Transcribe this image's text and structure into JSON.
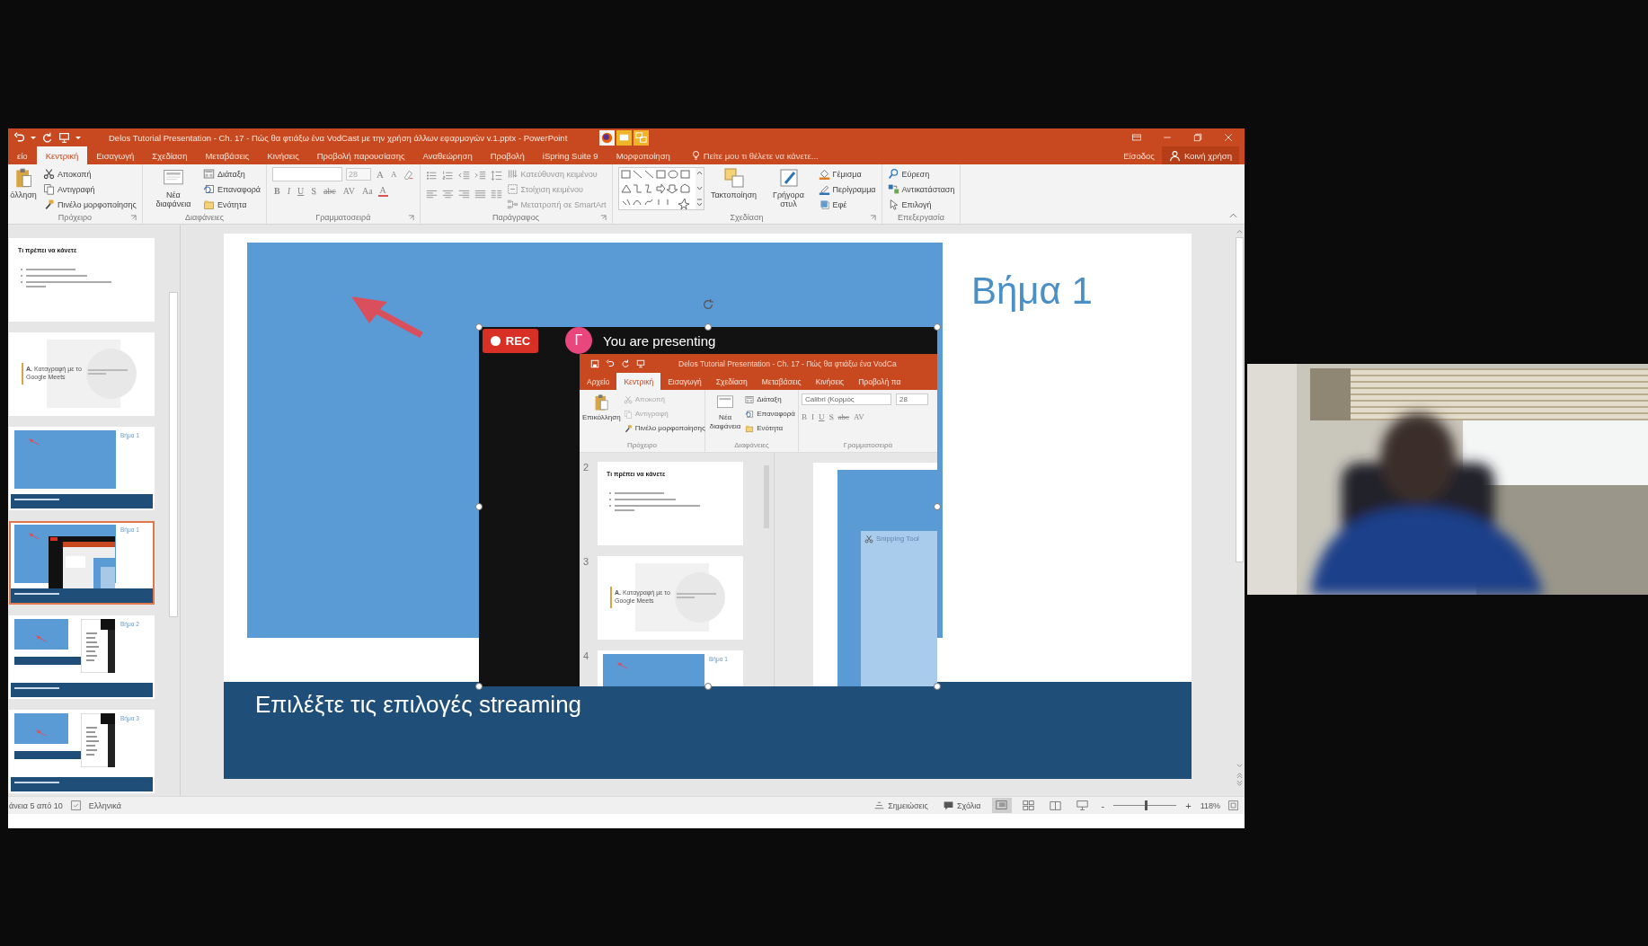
{
  "title_bar": {
    "title": "Delos Tutorial Presentation - Ch. 17 - Πώς θα φτιάξω ένα VodCast με την χρήση άλλων εφαρμογών v.1.pptx - PowerPoint"
  },
  "ribbon_tabs": [
    {
      "label": "είο",
      "selected": false
    },
    {
      "label": "Κεντρική",
      "selected": true
    },
    {
      "label": "Εισαγωγή",
      "selected": false
    },
    {
      "label": "Σχεδίαση",
      "selected": false
    },
    {
      "label": "Μεταβάσεις",
      "selected": false
    },
    {
      "label": "Κινήσεις",
      "selected": false
    },
    {
      "label": "Προβολή παρουσίασης",
      "selected": false
    },
    {
      "label": "Αναθεώρηση",
      "selected": false
    },
    {
      "label": "Προβολή",
      "selected": false
    },
    {
      "label": "iSpring Suite 9",
      "selected": false
    },
    {
      "label": "Μορφοποίηση",
      "selected": false
    }
  ],
  "tell_me": {
    "placeholder": "Πείτε μου τι θέλετε να κάνετε..."
  },
  "sign_in": "Είσοδος",
  "share": "Κοινή χρήση",
  "ribbon": {
    "clipboard": {
      "label": "Πρόχειρο",
      "paste": "όλληση",
      "items": [
        "Αποκοπή",
        "Αντιγραφή",
        "Πινέλο μορφοποίησης"
      ]
    },
    "slides": {
      "label": "Διαφάνειες",
      "new_slide": "Νέα διαφάνεια",
      "items": [
        "Διάταξη",
        "Επαναφορά",
        "Ενότητα"
      ]
    },
    "font": {
      "label": "Γραμματοσειρά",
      "size": "28",
      "size_buttons": [
        "A",
        "A"
      ],
      "format_buttons": [
        "B",
        "I",
        "U",
        "S",
        "abc",
        "AV",
        "Aa",
        "A"
      ]
    },
    "paragraph": {
      "label": "Παράγραφος",
      "items": [
        "Κατεύθυνση κειμένου",
        "Στοίχιση κειμένου",
        "Μετατροπή σε SmartArt"
      ]
    },
    "drawing": {
      "label": "Σχεδίαση",
      "big": [
        "Τακτοποίηση",
        "Γρήγορα στυλ"
      ],
      "items": [
        "Γέμισμα",
        "Περίγραμμα",
        "Εφέ"
      ]
    },
    "editing": {
      "label": "Επεξεργασία",
      "items": [
        "Εύρεση",
        "Αντικατάσταση",
        "Επιλογή"
      ]
    }
  },
  "thumbnails": [
    {
      "kind": "text",
      "title": "Τι πρέπει να κάνετε",
      "selected": false
    },
    {
      "kind": "section",
      "title": "**A.** Καταγραφή με το Google Meets",
      "selected": false
    },
    {
      "kind": "step",
      "title": "Βήμα 1",
      "selected": false
    },
    {
      "kind": "step-shot",
      "title": "Βήμα 1",
      "selected": true
    },
    {
      "kind": "step-menu",
      "title": "Βήμα 2",
      "selected": false
    },
    {
      "kind": "step-menu",
      "title": "Βήμα 3",
      "selected": false
    }
  ],
  "slide": {
    "title": "Βήμα 1",
    "caption": "Επιλέξτε τις επιλογές streaming"
  },
  "shared_screen": {
    "rec": "REC",
    "avatar": "Γ",
    "presenting": "You are presenting",
    "title": "Delos Tutorial Presentation - Ch. 17 - Πώς θα φτιάξω ένα VodCa",
    "tabs": [
      {
        "label": "Αρχείο",
        "selected": false
      },
      {
        "label": "Κεντρική",
        "selected": true
      },
      {
        "label": "Εισαγωγή",
        "selected": false
      },
      {
        "label": "Σχεδίαση",
        "selected": false
      },
      {
        "label": "Μεταβάσεις",
        "selected": false
      },
      {
        "label": "Κινήσεις",
        "selected": false
      },
      {
        "label": "Προβολή πα",
        "selected": false
      }
    ],
    "clipboard": {
      "label": "Πρόχειρο",
      "paste": "Επικόλληση",
      "items": [
        {
          "label": "Αποκοπή",
          "disabled": true
        },
        {
          "label": "Αντιγραφή",
          "disabled": true
        },
        {
          "label": "Πινέλο μορφοποίησης",
          "disabled": false
        }
      ]
    },
    "slides": {
      "label": "Διαφάνειες",
      "new_slide": "Νέα διαφάνεια",
      "items": [
        "Διάταξη",
        "Επαναφορά",
        "Ενότητα"
      ]
    },
    "font": {
      "label": "Γραμματοσειρά",
      "name": "Calibri (Κορμός",
      "size": "28",
      "format_buttons": [
        "B",
        "I",
        "U",
        "S",
        "abc",
        "AV"
      ]
    },
    "thumbnails": [
      {
        "number": "2",
        "kind": "text",
        "title": "Τι πρέπει να κάνετε"
      },
      {
        "number": "3",
        "kind": "section",
        "title": "**A.** Καταγραφή με το Google Meets"
      },
      {
        "number": "4",
        "kind": "step",
        "title": "Βήμα 1"
      }
    ],
    "snipping_tool": "Snipping Tool"
  },
  "status_bar": {
    "slide_info": "άνεια 5 από 10",
    "language": "Ελληνικά",
    "notes": "Σημειώσεις",
    "comments": "Σχόλια",
    "views": [
      {
        "kind": "normal",
        "selected": true
      },
      {
        "kind": "sorter",
        "selected": false
      },
      {
        "kind": "reading",
        "selected": false
      },
      {
        "kind": "slideshow",
        "selected": false
      }
    ],
    "zoom_out": "-",
    "zoom_in": "+",
    "zoom": {
      "level": 0.5
    },
    "zoom_reading": "118%"
  }
}
